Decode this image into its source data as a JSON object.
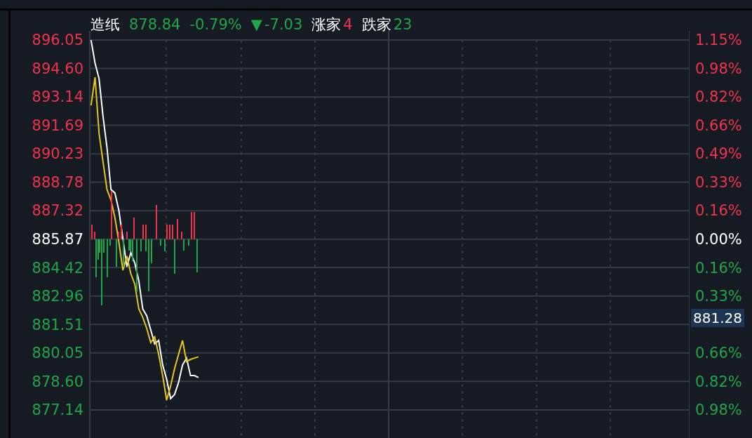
{
  "header": [
    {
      "text": "造纸",
      "kind": "plain"
    },
    {
      "text": "878.84",
      "kind": "down"
    },
    {
      "text": "-0.79%",
      "kind": "down"
    },
    {
      "text": "▼",
      "kind": "down"
    },
    {
      "text": "-7.03",
      "kind": "down"
    },
    {
      "text": "涨家",
      "kind": "plain"
    },
    {
      "text": "4",
      "kind": "up"
    },
    {
      "text": "跌家",
      "kind": "plain"
    },
    {
      "text": "23",
      "kind": "down"
    }
  ],
  "chart_data": {
    "type": "line",
    "grid": true,
    "ylim": [
      875.7,
      896.52
    ],
    "categories": [
      null,
      null,
      null,
      null,
      null,
      null,
      null,
      null,
      null,
      null,
      null,
      null,
      null,
      null,
      null,
      null,
      null,
      null,
      null,
      null,
      null,
      null,
      null,
      null,
      null,
      null,
      null,
      null,
      null,
      null,
      null,
      null,
      null,
      null,
      null,
      null,
      null,
      null,
      null,
      null,
      null,
      null,
      null,
      null,
      null,
      null,
      null,
      null,
      null,
      null,
      null,
      null,
      null,
      null,
      null,
      null,
      null,
      null,
      null,
      null,
      null,
      null,
      null,
      null,
      null,
      null,
      null,
      null,
      null,
      null,
      null,
      null,
      null,
      null,
      null,
      null,
      null,
      null,
      null,
      null,
      null,
      null,
      null,
      null,
      null,
      null,
      null,
      null,
      null,
      null,
      null,
      null,
      null,
      null,
      null,
      null,
      null,
      null,
      null,
      null,
      null,
      null,
      null,
      null,
      null,
      null,
      null,
      null,
      null,
      null,
      null,
      null,
      null,
      null,
      null,
      null,
      null,
      null,
      null,
      null,
      null,
      null,
      null,
      null,
      null,
      null,
      null,
      null,
      null,
      null,
      null,
      null,
      null,
      null,
      null,
      null,
      null,
      null,
      null,
      null,
      null,
      null,
      null,
      null,
      null,
      null,
      null,
      null,
      null,
      null,
      null
    ],
    "series": [
      {
        "color": "#ffffff",
        "values": [
          896.05,
          894.87,
          894.08,
          892.17,
          890.56,
          888.41,
          888.23,
          887.33,
          885.89,
          884.46,
          885.18,
          884.64,
          883.74,
          882.3,
          881.95,
          881.23,
          880.51,
          880.69,
          879.43,
          878.72,
          877.71,
          877.93,
          878.54,
          879.43,
          879.79,
          878.89,
          878.89,
          878.79,
          null,
          null,
          null,
          null,
          null,
          null,
          null,
          null,
          null,
          null,
          null,
          null,
          null,
          null,
          null,
          null,
          null,
          null,
          null,
          null,
          null,
          null,
          null,
          null,
          null,
          null,
          null,
          null,
          null,
          null,
          null,
          null,
          null,
          null,
          null,
          null,
          null,
          null,
          null,
          null,
          null,
          null,
          null,
          null,
          null,
          null,
          null,
          null,
          null,
          null,
          null,
          null,
          null,
          null,
          null,
          null,
          null,
          null,
          null,
          null,
          null,
          null,
          null,
          null,
          null,
          null,
          null,
          null,
          null,
          null,
          null,
          null,
          null,
          null,
          null,
          null,
          null,
          null,
          null,
          null,
          null,
          null,
          null,
          null,
          null,
          null,
          null,
          null,
          null,
          null,
          null,
          null,
          null,
          null,
          null,
          null,
          null,
          null,
          null,
          null,
          null,
          null,
          null,
          null,
          null,
          null,
          null,
          null,
          null,
          null,
          null,
          null,
          null,
          null,
          null,
          null,
          null,
          null,
          null,
          null,
          null,
          null,
          null
        ]
      },
      {
        "color": "#e6c619",
        "values": [
          892.71,
          894.15,
          891.28,
          889.84,
          888.41,
          887.87,
          886.97,
          885.71,
          884.28,
          885.0,
          884.1,
          883.56,
          882.3,
          881.87,
          881.3,
          880.58,
          880.87,
          879.97,
          878.89,
          877.64,
          878.36,
          879.25,
          879.97,
          880.69,
          879.61,
          879.72,
          879.79,
          879.85,
          null,
          null,
          null,
          null,
          null,
          null,
          null,
          null,
          null,
          null,
          null,
          null,
          null,
          null,
          null,
          null,
          null,
          null,
          null,
          null,
          null,
          null,
          null,
          null,
          null,
          null,
          null,
          null,
          null,
          null,
          null,
          null,
          null,
          null,
          null,
          null,
          null,
          null,
          null,
          null,
          null,
          null,
          null,
          null,
          null,
          null,
          null,
          null,
          null,
          null,
          null,
          null,
          null,
          null,
          null,
          null,
          null,
          null,
          null,
          null,
          null,
          null,
          null,
          null,
          null,
          null,
          null,
          null,
          null,
          null,
          null,
          null,
          null,
          null,
          null,
          null,
          null,
          null,
          null,
          null,
          null,
          null,
          null,
          null,
          null,
          null,
          null,
          null,
          null,
          null,
          null,
          null,
          null,
          null,
          null,
          null,
          null,
          null,
          null,
          null,
          null,
          null,
          null,
          null,
          null,
          null,
          null,
          null,
          null,
          null,
          null,
          null,
          null,
          null,
          null,
          null,
          null,
          null,
          null,
          null,
          null,
          null,
          null
        ]
      }
    ],
    "yticks": [
      {
        "value": 896.05,
        "label": "896.05"
      },
      {
        "value": 894.6,
        "label": "894.60"
      },
      {
        "value": 893.14,
        "label": "893.14"
      },
      {
        "value": 891.69,
        "label": "891.69"
      },
      {
        "value": 890.23,
        "label": "890.23"
      },
      {
        "value": 888.78,
        "label": "888.78"
      },
      {
        "value": 887.32,
        "label": "887.32"
      },
      {
        "value": 885.87,
        "label": "885.87"
      },
      {
        "value": 884.42,
        "label": "884.42"
      },
      {
        "value": 882.96,
        "label": "882.96"
      },
      {
        "value": 881.51,
        "label": "881.51"
      },
      {
        "value": 880.05,
        "label": "880.05"
      },
      {
        "value": 878.6,
        "label": "878.60"
      },
      {
        "value": 877.14,
        "label": "877.14"
      }
    ]
  },
  "right_axis": [
    {
      "label": "1.15%",
      "kind": "up"
    },
    {
      "label": "0.98%",
      "kind": "up"
    },
    {
      "label": "0.82%",
      "kind": "up"
    },
    {
      "label": "0.66%",
      "kind": "up"
    },
    {
      "label": "0.49%",
      "kind": "up"
    },
    {
      "label": "0.33%",
      "kind": "up"
    },
    {
      "label": "0.16%",
      "kind": "up"
    },
    {
      "label": "0.00%",
      "kind": "flat"
    },
    {
      "label": "0.16%",
      "kind": "down"
    },
    {
      "label": "0.33%",
      "kind": "down"
    },
    {
      "label": "881.28",
      "kind": "cursor"
    },
    {
      "label": "0.66%",
      "kind": "down"
    },
    {
      "label": "0.82%",
      "kind": "down"
    },
    {
      "label": "0.98%",
      "kind": "down"
    }
  ]
}
